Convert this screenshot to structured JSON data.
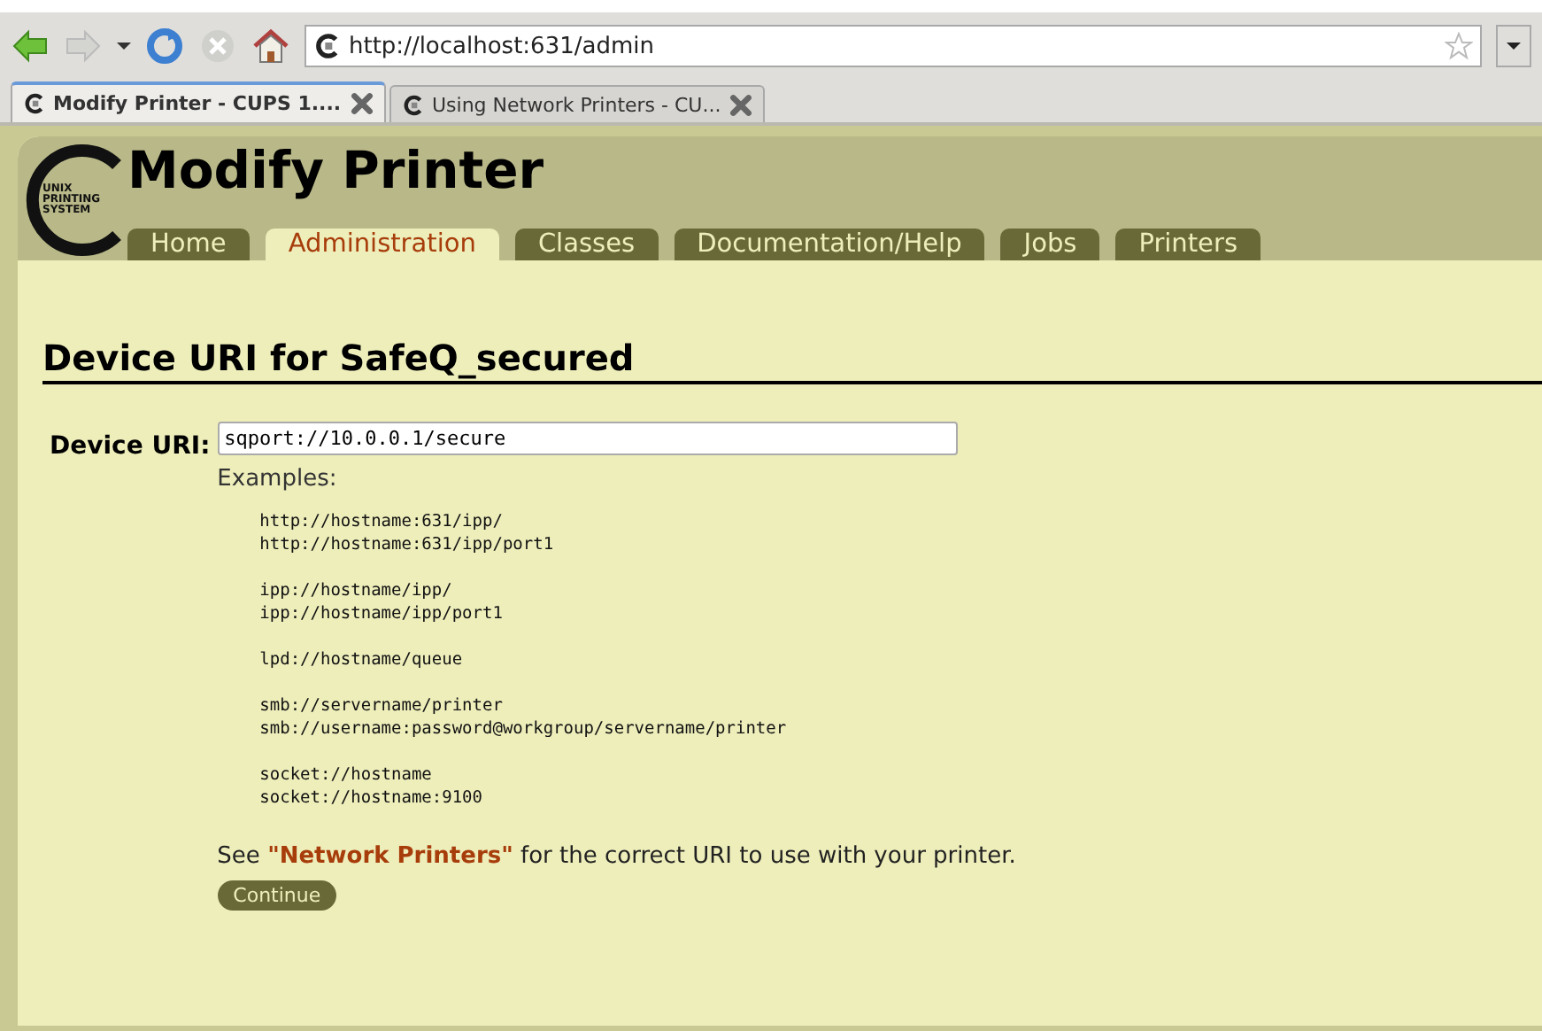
{
  "browser": {
    "url": "http://localhost:631/admin",
    "tabs": [
      {
        "title": "Modify Printer - CUPS 1....",
        "selected": true
      },
      {
        "title": "Using Network Printers - CU...",
        "selected": false
      }
    ]
  },
  "header": {
    "logo_text": [
      "UNIX",
      "PRINTING",
      "SYSTEM"
    ],
    "title": "Modify Printer",
    "nav": [
      {
        "label": "Home",
        "selected": false
      },
      {
        "label": "Administration",
        "selected": true
      },
      {
        "label": "Classes",
        "selected": false
      },
      {
        "label": "Documentation/Help",
        "selected": false
      },
      {
        "label": "Jobs",
        "selected": false
      },
      {
        "label": "Printers",
        "selected": false
      }
    ]
  },
  "heading": "Device URI for SafeQ_secured",
  "form": {
    "label": "Device URI:",
    "value": "sqport://10.0.0.1/secure",
    "examples_label": "Examples:",
    "example_groups": [
      [
        "http://hostname:631/ipp/",
        "http://hostname:631/ipp/port1"
      ],
      [
        "ipp://hostname/ipp/",
        "ipp://hostname/ipp/port1"
      ],
      [
        "lpd://hostname/queue"
      ],
      [
        "smb://servername/printer",
        "smb://username:password@workgroup/servername/printer"
      ],
      [
        "socket://hostname",
        "socket://hostname:9100"
      ]
    ],
    "note": {
      "before": "See ",
      "link": "\"Network Printers\"",
      "after": " for the correct URI to use with your printer."
    },
    "button": "Continue"
  }
}
